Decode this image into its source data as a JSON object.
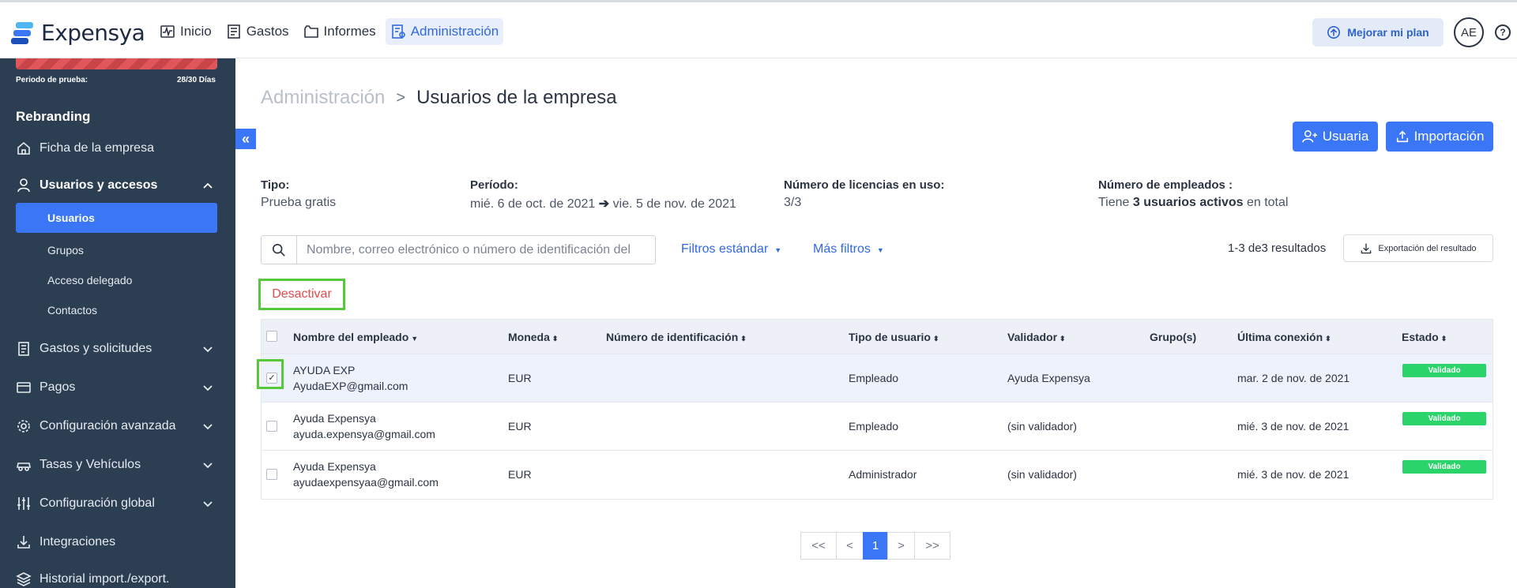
{
  "app": {
    "name": "Expensya"
  },
  "topnav": {
    "items": [
      {
        "label": "Inicio",
        "icon": "activity-icon"
      },
      {
        "label": "Gastos",
        "icon": "receipt-icon"
      },
      {
        "label": "Informes",
        "icon": "folder-icon"
      },
      {
        "label": "Administración",
        "icon": "admin-icon",
        "active": true
      }
    ],
    "upgrade_label": "Mejorar mi plan",
    "avatar_initials": "AE",
    "help_glyph": "?"
  },
  "sidebar": {
    "trial_label": "Periodo de prueba:",
    "trial_days": "28/30 Días",
    "company": "Rebranding",
    "items": [
      {
        "label": "Ficha de la empresa",
        "icon": "home-icon"
      },
      {
        "label": "Usuarios y accesos",
        "icon": "user-icon",
        "expanded": true
      },
      {
        "label": "Gastos y solicitudes",
        "icon": "receipt-icon"
      },
      {
        "label": "Pagos",
        "icon": "card-icon"
      },
      {
        "label": "Configuración avanzada",
        "icon": "gear-icon"
      },
      {
        "label": "Tasas y Vehículos",
        "icon": "car-icon"
      },
      {
        "label": "Configuración global",
        "icon": "sliders-icon"
      },
      {
        "label": "Integraciones",
        "icon": "download-icon"
      },
      {
        "label": "Historial import./export.",
        "icon": "layers-icon"
      }
    ],
    "subitems": [
      {
        "label": "Usuarios",
        "active": true
      },
      {
        "label": "Grupos"
      },
      {
        "label": "Acceso delegado"
      },
      {
        "label": "Contactos"
      }
    ],
    "collapse_glyph": "«"
  },
  "breadcrumb": {
    "parent": "Administración",
    "separator": ">",
    "current": "Usuarios de la empresa"
  },
  "actions": {
    "add_user": "Usuaria",
    "import": "Importación"
  },
  "info": {
    "tipo_label": "Tipo:",
    "tipo_value": "Prueba gratis",
    "periodo_label": "Período:",
    "periodo_start": "mié. 6 de oct. de 2021",
    "periodo_arrow": "➔",
    "periodo_end": "vie. 5 de nov. de 2021",
    "licencias_label": "Número de licencias en uso:",
    "licencias_value": "3/3",
    "empleados_label": "Número de empleados :",
    "empleados_prefix": "Tiene",
    "empleados_bold": "3 usuarios activos",
    "empleados_suffix": "en total"
  },
  "search": {
    "placeholder": "Nombre, correo electrónico o número de identificación del"
  },
  "filters": {
    "standard": "Filtros estándar",
    "more": "Más filtros",
    "caret": "▼"
  },
  "results": {
    "text": "1-3 de3 resultados",
    "export": "Exportación del resultado"
  },
  "deactivate_label": "Desactivar",
  "table": {
    "headers": [
      "Nombre del empleado",
      "Moneda",
      "Número de identificación",
      "Tipo de usuario",
      "Validador",
      "Grupo(s)",
      "Última conexión",
      "Estado"
    ],
    "sort_glyph": "⬍",
    "sort_active_glyph": "▼",
    "rows": [
      {
        "name": "AYUDA EXP",
        "email": "AyudaEXP@gmail.com",
        "currency": "EUR",
        "id_number": "",
        "user_type": "Empleado",
        "validator": "Ayuda Expensya",
        "groups": "",
        "last_login": "mar. 2 de nov. de 2021",
        "status": "Validado",
        "checked": true,
        "check_glyph": "✓"
      },
      {
        "name": "Ayuda Expensya",
        "email": "ayuda.expensya@gmail.com",
        "currency": "EUR",
        "id_number": "",
        "user_type": "Empleado",
        "validator": "(sin validador)",
        "groups": "",
        "last_login": "mié. 3 de nov. de 2021",
        "status": "Validado",
        "checked": false
      },
      {
        "name": "Ayuda Expensya",
        "email": "ayudaexpensyaa@gmail.com",
        "currency": "EUR",
        "id_number": "",
        "user_type": "Administrador",
        "validator": "(sin validador)",
        "groups": "",
        "last_login": "mié. 3 de nov. de 2021",
        "status": "Validado",
        "checked": false
      }
    ]
  },
  "pagination": {
    "first": "<<",
    "prev": "<",
    "current": "1",
    "next": ">",
    "last": ">>"
  },
  "colors": {
    "primary": "#3b76f6",
    "sidebar": "#2c3e52",
    "success": "#2bd36b",
    "danger": "#e54b4b",
    "highlight": "#56c93b"
  }
}
